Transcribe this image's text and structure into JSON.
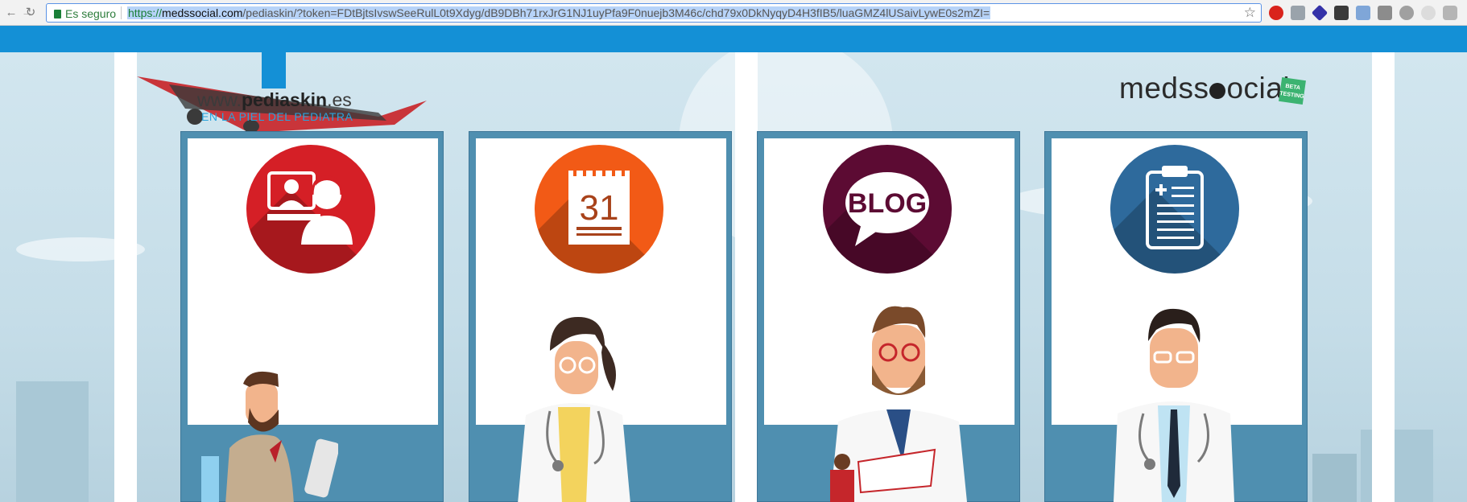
{
  "browser": {
    "secure_label": "Es seguro",
    "url_proto": "https://",
    "url_host": "medssocial.com",
    "url_path": "/pediaskin/?token=FDtBjtsIvswSeeRulL0t9Xdyg/dB9DBh71rxJrG1NJ1uyPfa9F0nuejb3M46c/chd79x0DkNyqyD4H3fIB5/luaGMZ4lUSaivLywE0s2mZI=",
    "back_icon": "arrow-left-icon",
    "forward_icon": "arrow-right-icon",
    "reload_icon": "reload-icon",
    "bookmark_icon": "star-icon",
    "extensions": [
      "adblock-icon",
      "extension-icon",
      "layers-icon",
      "notes-icon",
      "camera-icon",
      "puzzle-icon",
      "cloud-icon",
      "cloud-outline-icon",
      "pocket-icon"
    ]
  },
  "site": {
    "logo_prefix": "www.",
    "logo_bold": "pediaskin",
    "logo_suffix": ".es",
    "tagline": "EN LA PIEL DEL PEDIATRA",
    "brand_left": "meds",
    "brand_right": "ocial",
    "beta_badge": "BETA TESTING"
  },
  "cards": [
    {
      "icon": "video-consultation-icon",
      "color": "#d51f26",
      "glyph": "screen-headset"
    },
    {
      "icon": "calendar-icon",
      "color": "#f25a16",
      "glyph": "31"
    },
    {
      "icon": "blog-icon",
      "color": "#5c0b33",
      "glyph": "BLOG"
    },
    {
      "icon": "clipboard-icon",
      "color": "#2e6a9c",
      "glyph": "clipboard"
    }
  ],
  "colors": {
    "topbar": "#1490d6",
    "card_frame": "#4f8fb0"
  }
}
